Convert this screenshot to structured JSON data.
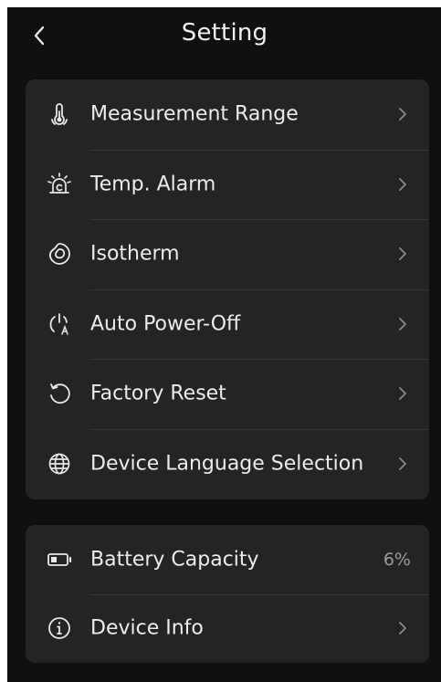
{
  "header": {
    "title": "Setting"
  },
  "settings_group": {
    "items": [
      {
        "label": "Measurement Range",
        "icon": "thermometer-range-icon"
      },
      {
        "label": "Temp. Alarm",
        "icon": "alarm-siren-icon"
      },
      {
        "label": "Isotherm",
        "icon": "isotherm-icon"
      },
      {
        "label": "Auto Power-Off",
        "icon": "auto-power-off-icon"
      },
      {
        "label": "Factory Reset",
        "icon": "reset-icon"
      },
      {
        "label": "Device Language Selection",
        "icon": "globe-icon"
      }
    ]
  },
  "info_group": {
    "battery": {
      "label": "Battery Capacity",
      "value": "6%",
      "icon": "battery-icon"
    },
    "device_info": {
      "label": "Device Info",
      "icon": "info-icon"
    }
  },
  "colors": {
    "background": "#101010",
    "card": "#242424",
    "text": "#ececec",
    "secondary_text": "#9a9a9a"
  }
}
